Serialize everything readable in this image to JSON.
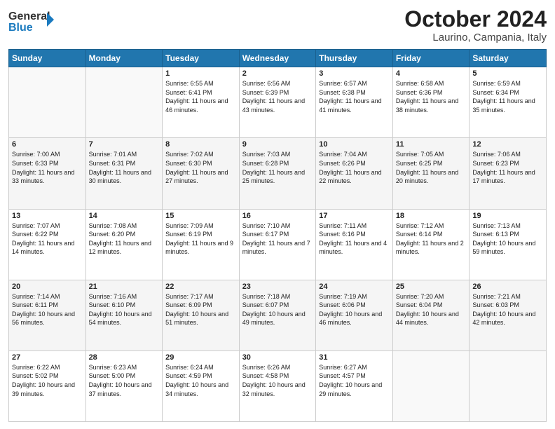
{
  "header": {
    "logo_line1": "General",
    "logo_line2": "Blue",
    "month_title": "October 2024",
    "location": "Laurino, Campania, Italy"
  },
  "weekdays": [
    "Sunday",
    "Monday",
    "Tuesday",
    "Wednesday",
    "Thursday",
    "Friday",
    "Saturday"
  ],
  "weeks": [
    [
      {
        "day": "",
        "info": ""
      },
      {
        "day": "",
        "info": ""
      },
      {
        "day": "1",
        "info": "Sunrise: 6:55 AM\nSunset: 6:41 PM\nDaylight: 11 hours and 46 minutes."
      },
      {
        "day": "2",
        "info": "Sunrise: 6:56 AM\nSunset: 6:39 PM\nDaylight: 11 hours and 43 minutes."
      },
      {
        "day": "3",
        "info": "Sunrise: 6:57 AM\nSunset: 6:38 PM\nDaylight: 11 hours and 41 minutes."
      },
      {
        "day": "4",
        "info": "Sunrise: 6:58 AM\nSunset: 6:36 PM\nDaylight: 11 hours and 38 minutes."
      },
      {
        "day": "5",
        "info": "Sunrise: 6:59 AM\nSunset: 6:34 PM\nDaylight: 11 hours and 35 minutes."
      }
    ],
    [
      {
        "day": "6",
        "info": "Sunrise: 7:00 AM\nSunset: 6:33 PM\nDaylight: 11 hours and 33 minutes."
      },
      {
        "day": "7",
        "info": "Sunrise: 7:01 AM\nSunset: 6:31 PM\nDaylight: 11 hours and 30 minutes."
      },
      {
        "day": "8",
        "info": "Sunrise: 7:02 AM\nSunset: 6:30 PM\nDaylight: 11 hours and 27 minutes."
      },
      {
        "day": "9",
        "info": "Sunrise: 7:03 AM\nSunset: 6:28 PM\nDaylight: 11 hours and 25 minutes."
      },
      {
        "day": "10",
        "info": "Sunrise: 7:04 AM\nSunset: 6:26 PM\nDaylight: 11 hours and 22 minutes."
      },
      {
        "day": "11",
        "info": "Sunrise: 7:05 AM\nSunset: 6:25 PM\nDaylight: 11 hours and 20 minutes."
      },
      {
        "day": "12",
        "info": "Sunrise: 7:06 AM\nSunset: 6:23 PM\nDaylight: 11 hours and 17 minutes."
      }
    ],
    [
      {
        "day": "13",
        "info": "Sunrise: 7:07 AM\nSunset: 6:22 PM\nDaylight: 11 hours and 14 minutes."
      },
      {
        "day": "14",
        "info": "Sunrise: 7:08 AM\nSunset: 6:20 PM\nDaylight: 11 hours and 12 minutes."
      },
      {
        "day": "15",
        "info": "Sunrise: 7:09 AM\nSunset: 6:19 PM\nDaylight: 11 hours and 9 minutes."
      },
      {
        "day": "16",
        "info": "Sunrise: 7:10 AM\nSunset: 6:17 PM\nDaylight: 11 hours and 7 minutes."
      },
      {
        "day": "17",
        "info": "Sunrise: 7:11 AM\nSunset: 6:16 PM\nDaylight: 11 hours and 4 minutes."
      },
      {
        "day": "18",
        "info": "Sunrise: 7:12 AM\nSunset: 6:14 PM\nDaylight: 11 hours and 2 minutes."
      },
      {
        "day": "19",
        "info": "Sunrise: 7:13 AM\nSunset: 6:13 PM\nDaylight: 10 hours and 59 minutes."
      }
    ],
    [
      {
        "day": "20",
        "info": "Sunrise: 7:14 AM\nSunset: 6:11 PM\nDaylight: 10 hours and 56 minutes."
      },
      {
        "day": "21",
        "info": "Sunrise: 7:16 AM\nSunset: 6:10 PM\nDaylight: 10 hours and 54 minutes."
      },
      {
        "day": "22",
        "info": "Sunrise: 7:17 AM\nSunset: 6:09 PM\nDaylight: 10 hours and 51 minutes."
      },
      {
        "day": "23",
        "info": "Sunrise: 7:18 AM\nSunset: 6:07 PM\nDaylight: 10 hours and 49 minutes."
      },
      {
        "day": "24",
        "info": "Sunrise: 7:19 AM\nSunset: 6:06 PM\nDaylight: 10 hours and 46 minutes."
      },
      {
        "day": "25",
        "info": "Sunrise: 7:20 AM\nSunset: 6:04 PM\nDaylight: 10 hours and 44 minutes."
      },
      {
        "day": "26",
        "info": "Sunrise: 7:21 AM\nSunset: 6:03 PM\nDaylight: 10 hours and 42 minutes."
      }
    ],
    [
      {
        "day": "27",
        "info": "Sunrise: 6:22 AM\nSunset: 5:02 PM\nDaylight: 10 hours and 39 minutes."
      },
      {
        "day": "28",
        "info": "Sunrise: 6:23 AM\nSunset: 5:00 PM\nDaylight: 10 hours and 37 minutes."
      },
      {
        "day": "29",
        "info": "Sunrise: 6:24 AM\nSunset: 4:59 PM\nDaylight: 10 hours and 34 minutes."
      },
      {
        "day": "30",
        "info": "Sunrise: 6:26 AM\nSunset: 4:58 PM\nDaylight: 10 hours and 32 minutes."
      },
      {
        "day": "31",
        "info": "Sunrise: 6:27 AM\nSunset: 4:57 PM\nDaylight: 10 hours and 29 minutes."
      },
      {
        "day": "",
        "info": ""
      },
      {
        "day": "",
        "info": ""
      }
    ]
  ]
}
